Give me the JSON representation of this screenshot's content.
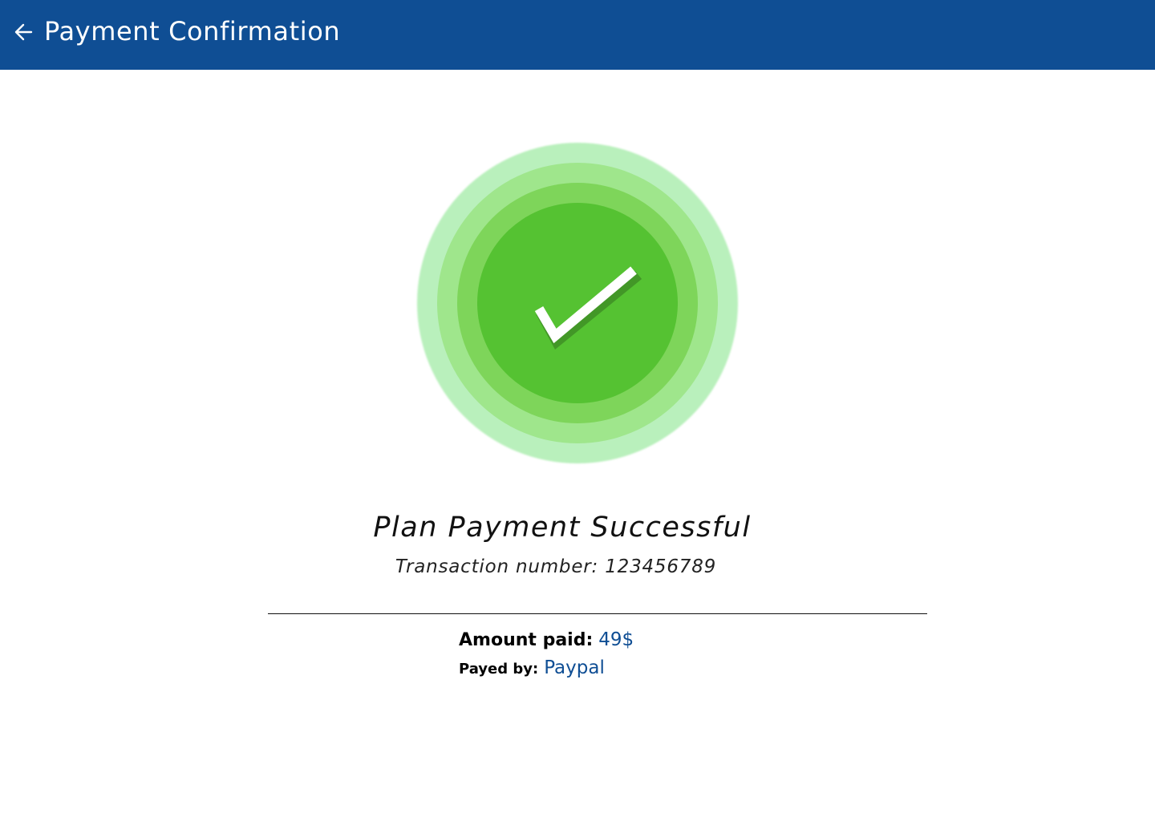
{
  "header": {
    "title": "Payment Confirmation",
    "back_icon": "arrow-left-icon",
    "background_color": "#0f4e94"
  },
  "status": {
    "icon": "checkmark-icon",
    "title": "Plan Payment Successful",
    "transaction_label": "Transaction number:",
    "transaction_number": "123456789",
    "accent_color": "#55c232"
  },
  "details": {
    "amount_label": "Amount paid:",
    "amount_value": "49$",
    "payer_label": "Payed by:",
    "payer_value": "Paypal",
    "value_color": "#0f4e94"
  }
}
